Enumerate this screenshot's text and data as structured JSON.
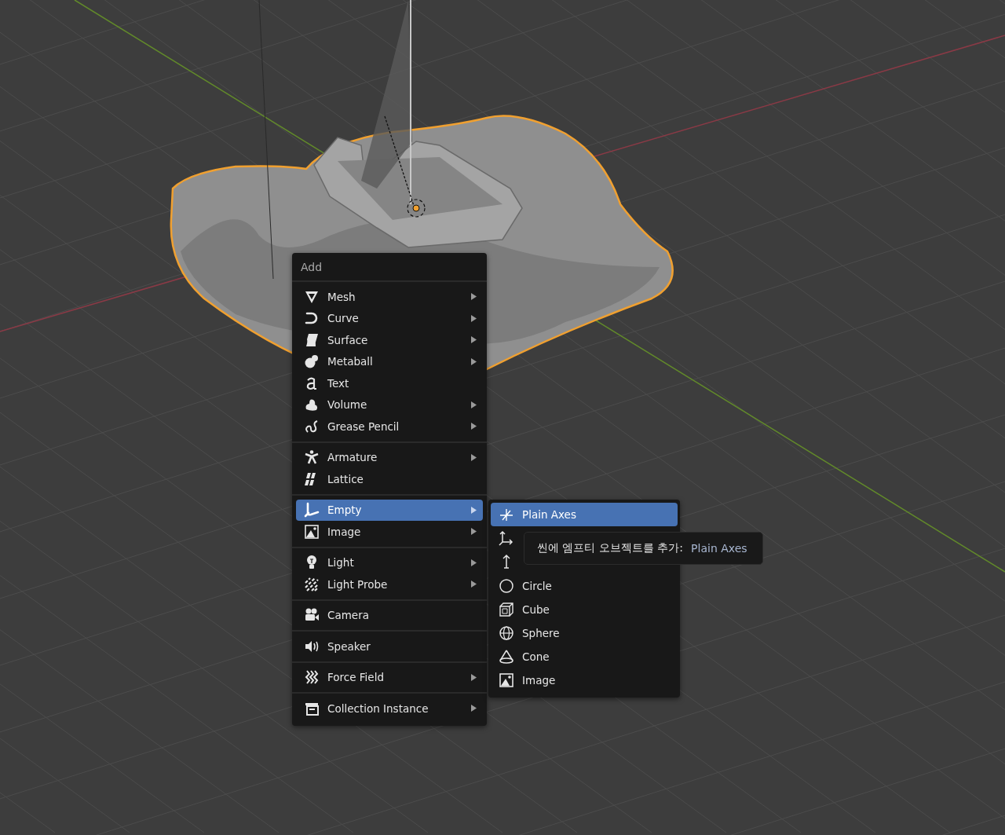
{
  "menu": {
    "title": "Add",
    "groups": [
      {
        "items": [
          {
            "label": "Mesh",
            "kind": "mesh",
            "has_submenu": true,
            "selected": false
          },
          {
            "label": "Curve",
            "kind": "curve",
            "has_submenu": true,
            "selected": false
          },
          {
            "label": "Surface",
            "kind": "surface",
            "has_submenu": true,
            "selected": false
          },
          {
            "label": "Metaball",
            "kind": "metaball",
            "has_submenu": true,
            "selected": false
          },
          {
            "label": "Text",
            "kind": "text",
            "has_submenu": false,
            "selected": false
          },
          {
            "label": "Volume",
            "kind": "volume",
            "has_submenu": true,
            "selected": false
          },
          {
            "label": "Grease Pencil",
            "kind": "pencil",
            "has_submenu": true,
            "selected": false
          }
        ]
      },
      {
        "items": [
          {
            "label": "Armature",
            "kind": "armature",
            "has_submenu": true,
            "selected": false
          },
          {
            "label": "Lattice",
            "kind": "lattice",
            "has_submenu": false,
            "selected": false
          }
        ]
      },
      {
        "items": [
          {
            "label": "Empty",
            "kind": "empty",
            "has_submenu": true,
            "selected": true
          },
          {
            "label": "Image",
            "kind": "image",
            "has_submenu": true,
            "selected": false
          }
        ]
      },
      {
        "items": [
          {
            "label": "Light",
            "kind": "light",
            "has_submenu": true,
            "selected": false
          },
          {
            "label": "Light Probe",
            "kind": "probe",
            "has_submenu": true,
            "selected": false
          }
        ]
      },
      {
        "items": [
          {
            "label": "Camera",
            "kind": "camera",
            "has_submenu": false,
            "selected": false
          }
        ]
      },
      {
        "items": [
          {
            "label": "Speaker",
            "kind": "speaker",
            "has_submenu": false,
            "selected": false
          }
        ]
      },
      {
        "items": [
          {
            "label": "Force Field",
            "kind": "force",
            "has_submenu": true,
            "selected": false
          }
        ]
      },
      {
        "items": [
          {
            "label": "Collection Instance",
            "kind": "collection",
            "has_submenu": true,
            "selected": false
          }
        ]
      }
    ]
  },
  "submenu": {
    "items": [
      {
        "label": "Plain Axes",
        "kind": "plain_axes",
        "selected": true
      },
      {
        "kind": "arrows",
        "selected": false
      },
      {
        "kind": "single_arrow",
        "selected": false
      },
      {
        "label": "Circle",
        "kind": "circle",
        "selected": false
      },
      {
        "label": "Cube",
        "kind": "cube",
        "selected": false
      },
      {
        "label": "Sphere",
        "kind": "sphere",
        "selected": false
      },
      {
        "label": "Cone",
        "kind": "cone",
        "selected": false
      },
      {
        "label": "Image",
        "kind": "image",
        "selected": false
      }
    ]
  },
  "tooltip": {
    "text": "씬에 엠프티 오브젝트를 추가:",
    "value": "Plain Axes"
  }
}
